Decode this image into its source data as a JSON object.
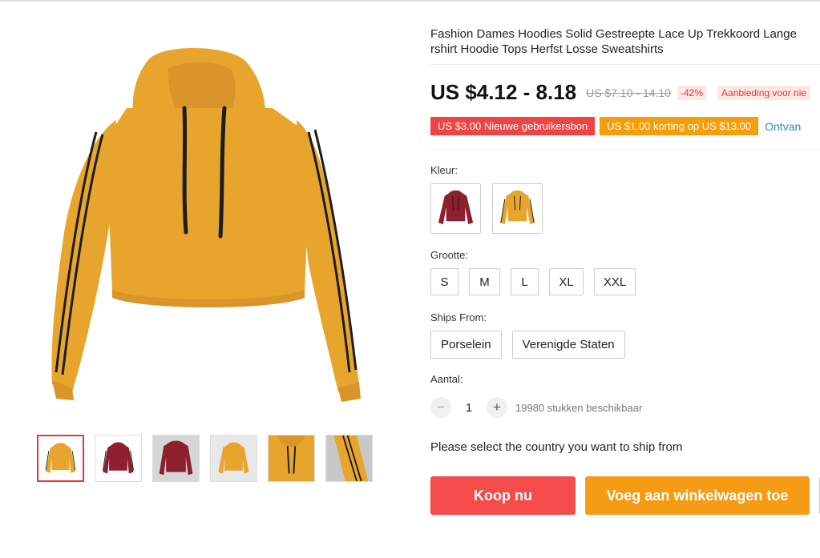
{
  "product": {
    "title_line1": "Fashion Dames Hoodies Solid Gestreepte Lace Up Trekkoord Lange",
    "title_line2": "rshirt Hoodie Tops Herfst Losse Sweatshirts"
  },
  "pricing": {
    "price": "US $4.12 - 8.18",
    "original_price": "US $7.10 - 14.10",
    "discount": "-42%",
    "promo_label": "Aanbieding voor nie"
  },
  "coupons": {
    "new_user": "US $3.00 Nieuwe gebruikersbon",
    "discount": "US $1.00 korting op US $13.00",
    "receive": "Ontvan"
  },
  "options": {
    "color_label": "Kleur:",
    "colors": [
      "burgundy-hoodie",
      "mustard-hoodie"
    ],
    "size_label": "Grootte:",
    "sizes": [
      "S",
      "M",
      "L",
      "XL",
      "XXL"
    ],
    "ships_label": "Ships From:",
    "ships": [
      "Porselein",
      "Verenigde Staten"
    ],
    "qty_label": "Aantal:",
    "qty_minus": "−",
    "qty_value": "1",
    "qty_plus": "+",
    "available": "19980 stukken beschikbaar"
  },
  "shipping_message": "Please select the country you want to ship from",
  "actions": {
    "buy_now": "Koop nu",
    "add_to_cart": "Voeg aan winkelwagen toe"
  },
  "colors": {
    "mustard": "#E8A52E",
    "burgundy": "#8E1F2E",
    "stripe": "#1c1c1c",
    "buy": "#F44B4B",
    "cart": "#F59C14",
    "link": "#2F86C0"
  }
}
